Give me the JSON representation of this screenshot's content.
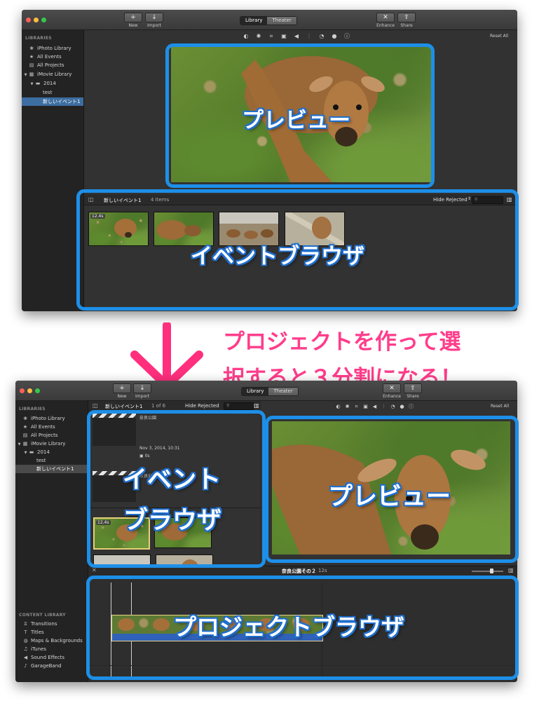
{
  "toolbar": {
    "new_label": "New",
    "import_label": "Import",
    "library_tab": "Library",
    "theater_tab": "Theater",
    "enhance_label": "Enhance",
    "share_label": "Share",
    "reset_all": "Reset All"
  },
  "sidebar": {
    "libraries_header": "LIBRARIES",
    "items": [
      {
        "icon": "iphoto-icon",
        "label": "iPhoto Library"
      },
      {
        "icon": "star-icon",
        "label": "All Events"
      },
      {
        "icon": "film-icon",
        "label": "All Projects"
      },
      {
        "icon": "grid-icon",
        "label": "iMovie Library"
      },
      {
        "icon": "folder-icon",
        "label": "2014"
      },
      {
        "icon": "",
        "label": "test"
      },
      {
        "icon": "",
        "label": "新しいイベント1"
      }
    ],
    "content_library_header": "CONTENT LIBRARY",
    "content_items": [
      {
        "icon": "transitions-icon",
        "label": "Transitions"
      },
      {
        "icon": "titles-icon",
        "label": "Titles"
      },
      {
        "icon": "globe-icon",
        "label": "Maps & Backgrounds"
      },
      {
        "icon": "music-icon",
        "label": "iTunes"
      },
      {
        "icon": "speaker-icon",
        "label": "Sound Effects"
      },
      {
        "icon": "guitar-icon",
        "label": "GarageBand"
      }
    ]
  },
  "event_browser": {
    "event_name": "新しいイベント1",
    "item_count": "4 Items",
    "filter": "Hide Rejected",
    "clip_duration": "12.4s"
  },
  "split_event_browser": {
    "event_name": "新しいイベント1",
    "page": "1 of 6",
    "filter": "Hide Rejected",
    "project1_name": "奈良公園",
    "project1_date": "Nov 3, 2014, 10:31",
    "project1_length": "0s",
    "project2_name": "奈良公園その２",
    "clip_duration": "12.4s"
  },
  "project_browser": {
    "title": "奈良公園その２",
    "length": "12s"
  },
  "annotations": {
    "preview": "プレビュー",
    "event_browser": "イベントブラウザ",
    "event_line1": "イベント",
    "event_line2": "ブラウザ",
    "project_browser": "プロジェクトブラウザ",
    "callout_line1": "プロジェクトを作って選",
    "callout_line2": "択すると３分割になる！"
  },
  "colors": {
    "annotation_blue": "#1d8fe8",
    "callout_pink": "#ff3d8b",
    "arrow_pink": "#ff2f7e",
    "selection": "#3d6ea1"
  }
}
